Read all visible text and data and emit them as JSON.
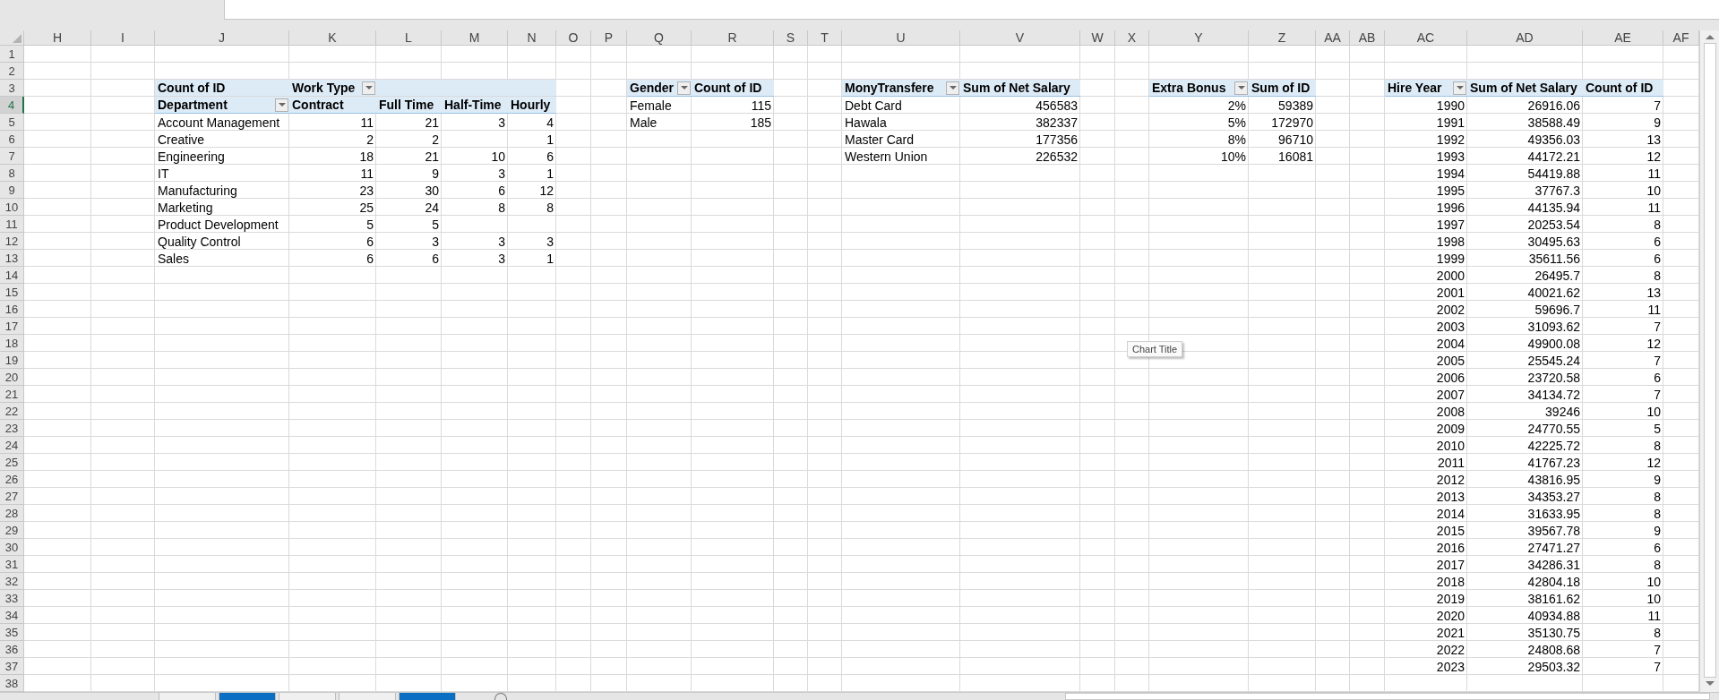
{
  "column_headers": [
    "H",
    "I",
    "J",
    "K",
    "L",
    "M",
    "N",
    "O",
    "P",
    "Q",
    "R",
    "S",
    "T",
    "U",
    "V",
    "W",
    "X",
    "Y",
    "Z",
    "AA",
    "AB",
    "AC",
    "AD",
    "AE",
    "AF"
  ],
  "row_headers": [
    {
      "label": "1",
      "selected": false
    },
    {
      "label": "2",
      "selected": false
    },
    {
      "label": "3",
      "selected": false
    },
    {
      "label": "4",
      "selected": true
    },
    {
      "label": "5",
      "selected": false
    },
    {
      "label": "6",
      "selected": false
    },
    {
      "label": "7",
      "selected": false
    },
    {
      "label": "8",
      "selected": false
    },
    {
      "label": "9",
      "selected": false
    },
    {
      "label": "10",
      "selected": false
    },
    {
      "label": "11",
      "selected": false
    },
    {
      "label": "12",
      "selected": false
    },
    {
      "label": "13",
      "selected": false
    },
    {
      "label": "14",
      "selected": false
    },
    {
      "label": "15",
      "selected": false
    },
    {
      "label": "16",
      "selected": false
    },
    {
      "label": "17",
      "selected": false
    },
    {
      "label": "18",
      "selected": false
    },
    {
      "label": "19",
      "selected": false
    },
    {
      "label": "20",
      "selected": false
    },
    {
      "label": "21",
      "selected": false
    },
    {
      "label": "22",
      "selected": false
    },
    {
      "label": "23",
      "selected": false
    },
    {
      "label": "24",
      "selected": false
    },
    {
      "label": "25",
      "selected": false
    },
    {
      "label": "26",
      "selected": false
    },
    {
      "label": "27",
      "selected": false
    },
    {
      "label": "28",
      "selected": false
    },
    {
      "label": "29",
      "selected": false
    },
    {
      "label": "30",
      "selected": false
    },
    {
      "label": "31",
      "selected": false
    },
    {
      "label": "32",
      "selected": false
    },
    {
      "label": "33",
      "selected": false
    },
    {
      "label": "34",
      "selected": false
    },
    {
      "label": "35",
      "selected": false
    },
    {
      "label": "36",
      "selected": false
    },
    {
      "label": "37",
      "selected": false
    },
    {
      "label": "38",
      "selected": false
    }
  ],
  "pivot_tables": [
    {
      "kind": "textual",
      "header_rows": [
        [
          {
            "text": "Count of ID",
            "filter": false
          },
          {
            "text": "Work Type",
            "filter": true
          },
          null,
          null,
          null
        ],
        [
          {
            "text": "Department",
            "filter": true
          },
          {
            "text": "Contract",
            "filter": false
          },
          {
            "text": "Full Time",
            "filter": false
          },
          {
            "text": "Half-Time",
            "filter": false
          },
          {
            "text": "Hourly",
            "filter": false
          }
        ]
      ],
      "rows": [
        [
          "Account Management",
          "11",
          "21",
          "3",
          "4"
        ],
        [
          "Creative",
          "2",
          "2",
          null,
          "1"
        ],
        [
          "Engineering",
          "18",
          "21",
          "10",
          "6"
        ],
        [
          "IT",
          "11",
          "9",
          "3",
          "1"
        ],
        [
          "Manufacturing",
          "23",
          "30",
          "6",
          "12"
        ],
        [
          "Marketing",
          "25",
          "24",
          "8",
          "8"
        ],
        [
          "Product Development",
          "5",
          "5",
          null,
          null
        ],
        [
          "Quality Control",
          "6",
          "3",
          "3",
          "3"
        ],
        [
          "Sales",
          "6",
          "6",
          "3",
          "1"
        ]
      ]
    },
    {
      "kind": "textual",
      "header_rows": [
        [
          {
            "text": "Gender",
            "filter": true
          },
          {
            "text": "Count of ID",
            "filter": false
          }
        ]
      ],
      "rows": [
        [
          "Female",
          "115"
        ],
        [
          "Male",
          "185"
        ]
      ]
    },
    {
      "kind": "textual",
      "header_rows": [
        [
          {
            "text": "MonyTransfere",
            "filter": true
          },
          {
            "text": "Sum of Net Salary",
            "filter": false
          }
        ]
      ],
      "rows": [
        [
          "Debt Card",
          "456583"
        ],
        [
          "Hawala",
          "382337"
        ],
        [
          "Master Card",
          "177356"
        ],
        [
          "Western Union",
          "226532"
        ]
      ]
    },
    {
      "kind": "numeric",
      "header_rows": [
        [
          {
            "text": "Extra Bonus",
            "filter": true
          },
          {
            "text": "Sum of ID",
            "filter": false
          }
        ]
      ],
      "rows": [
        [
          "2%",
          "59389"
        ],
        [
          "5%",
          "172970"
        ],
        [
          "8%",
          "96710"
        ],
        [
          "10%",
          "16081"
        ]
      ]
    },
    {
      "kind": "numeric",
      "header_rows": [
        [
          {
            "text": "Hire Year",
            "filter": true
          },
          {
            "text": "Sum of Net Salary",
            "filter": false
          },
          {
            "text": "Count of ID",
            "filter": false
          }
        ]
      ],
      "rows": [
        [
          "1990",
          "26916.06",
          "7"
        ],
        [
          "1991",
          "38588.49",
          "9"
        ],
        [
          "1992",
          "49356.03",
          "13"
        ],
        [
          "1993",
          "44172.21",
          "12"
        ],
        [
          "1994",
          "54419.88",
          "11"
        ],
        [
          "1995",
          "37767.3",
          "10"
        ],
        [
          "1996",
          "44135.94",
          "11"
        ],
        [
          "1997",
          "20253.54",
          "8"
        ],
        [
          "1998",
          "30495.63",
          "6"
        ],
        [
          "1999",
          "35611.56",
          "6"
        ],
        [
          "2000",
          "26495.7",
          "8"
        ],
        [
          "2001",
          "40021.62",
          "13"
        ],
        [
          "2002",
          "59696.7",
          "11"
        ],
        [
          "2003",
          "31093.62",
          "7"
        ],
        [
          "2004",
          "49900.08",
          "12"
        ],
        [
          "2005",
          "25545.24",
          "7"
        ],
        [
          "2006",
          "23720.58",
          "6"
        ],
        [
          "2007",
          "34134.72",
          "7"
        ],
        [
          "2008",
          "39246",
          "10"
        ],
        [
          "2009",
          "24770.55",
          "5"
        ],
        [
          "2010",
          "42225.72",
          "8"
        ],
        [
          "2011",
          "41767.23",
          "12"
        ],
        [
          "2012",
          "43816.95",
          "9"
        ],
        [
          "2013",
          "34353.27",
          "8"
        ],
        [
          "2014",
          "31633.95",
          "8"
        ],
        [
          "2015",
          "39567.78",
          "9"
        ],
        [
          "2016",
          "27471.27",
          "6"
        ],
        [
          "2017",
          "34286.31",
          "8"
        ],
        [
          "2018",
          "42804.18",
          "10"
        ],
        [
          "2019",
          "38161.62",
          "10"
        ],
        [
          "2020",
          "40934.88",
          "11"
        ],
        [
          "2021",
          "35130.75",
          "8"
        ],
        [
          "2022",
          "24808.68",
          "7"
        ],
        [
          "2023",
          "29503.32",
          "7"
        ]
      ]
    }
  ],
  "chart_title": "Chart Title",
  "sheet_tabs": [
    {
      "color": "#f0f0f0"
    },
    {
      "color": "#0a6fc2"
    },
    {
      "color": "#f0f0f0"
    },
    {
      "color": "#f0f0f0"
    },
    {
      "color": "#0a6fc2"
    }
  ]
}
